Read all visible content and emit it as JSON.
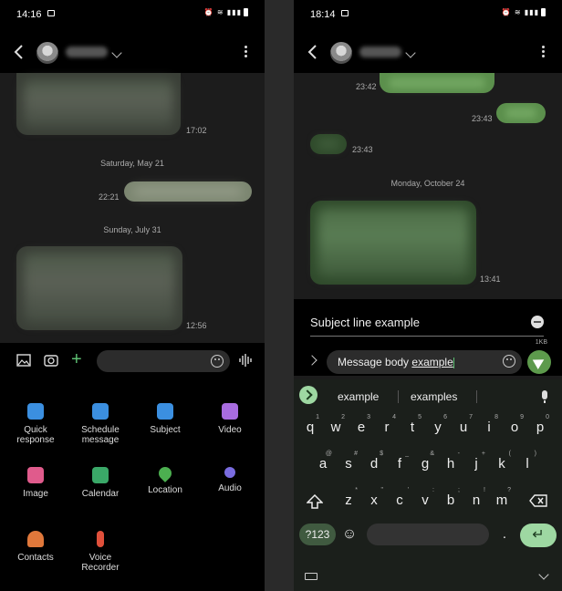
{
  "left": {
    "status": {
      "time": "14:16"
    },
    "messages": [
      {
        "time": "17:02"
      },
      {
        "time": "22:21"
      },
      {
        "time": "12:56"
      }
    ],
    "dates": [
      "Saturday, May 21",
      "Sunday, July 31"
    ],
    "attach_items": [
      {
        "label": "Quick\nresponse",
        "icon": "quick-response-icon",
        "color": "#3b8fe0"
      },
      {
        "label": "Schedule\nmessage",
        "icon": "schedule-icon",
        "color": "#3b8fe0"
      },
      {
        "label": "Subject",
        "icon": "subject-icon",
        "color": "#3b8fe0"
      },
      {
        "label": "Video",
        "icon": "video-icon",
        "color": "#a86ce0"
      },
      {
        "label": "Image",
        "icon": "image-icon",
        "color": "#e05b8c"
      },
      {
        "label": "Calendar",
        "icon": "calendar-icon",
        "color": "#3aa868"
      },
      {
        "label": "Location",
        "icon": "location-icon",
        "color": "#4caf50"
      },
      {
        "label": "Audio",
        "icon": "audio-icon",
        "color": "#7a6ce0"
      },
      {
        "label": "Contacts",
        "icon": "contacts-icon",
        "color": "#e0783b"
      },
      {
        "label": "Voice\nRecorder",
        "icon": "voice-recorder-icon",
        "color": "#e0503b"
      }
    ]
  },
  "right": {
    "status": {
      "time": "18:14"
    },
    "messages": [
      {
        "time": "23:42"
      },
      {
        "time": "23:43"
      },
      {
        "time": "23:43"
      },
      {
        "time": "13:41"
      }
    ],
    "date": "Monday, October 24",
    "subject": "Subject line example",
    "size": "1KB",
    "body_plain": "Message body ",
    "body_underlined": "example",
    "suggestions": [
      "example",
      "examples"
    ],
    "keys": {
      "row1": [
        "q",
        "w",
        "e",
        "r",
        "t",
        "y",
        "u",
        "i",
        "o",
        "p"
      ],
      "row1_hints": [
        "1",
        "2",
        "3",
        "4",
        "5",
        "6",
        "7",
        "8",
        "9",
        "0"
      ],
      "row2": [
        "a",
        "s",
        "d",
        "f",
        "g",
        "h",
        "j",
        "k",
        "l"
      ],
      "row2_hints": [
        "@",
        "#",
        "$",
        "_",
        "&",
        "-",
        "+",
        "(",
        ")"
      ],
      "row3": [
        "z",
        "x",
        "c",
        "v",
        "b",
        "n",
        "m"
      ],
      "row3_hints": [
        "*",
        "\"",
        "'",
        ":",
        ";",
        "!",
        "?"
      ],
      "symbols": "?123",
      "comma": ",",
      "period": "."
    }
  }
}
